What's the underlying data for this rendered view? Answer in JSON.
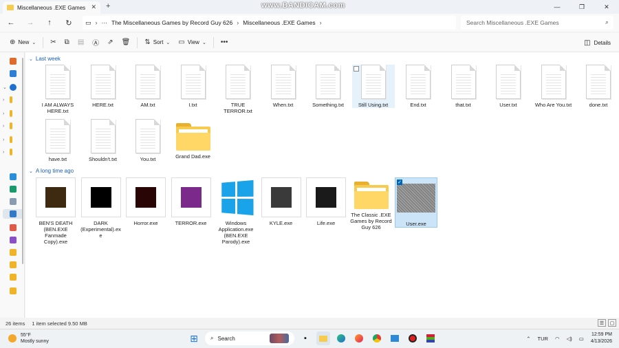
{
  "window": {
    "tab_title": "Miscellaneous .EXE Games",
    "watermark": "www.BANDICAM.com"
  },
  "address": {
    "crumbs": [
      "The Miscellaneous Games by Record Guy 626",
      "Miscellaneous .EXE Games"
    ],
    "search_placeholder": "Search Miscellaneous .EXE Games"
  },
  "commands": {
    "new": "New",
    "sort": "Sort",
    "view": "View",
    "details": "Details"
  },
  "groups": {
    "last_week": "Last week",
    "long_ago": "A long time ago"
  },
  "files_last_week": [
    {
      "name": "I AM ALWAYS HERE.txt",
      "kind": "doc"
    },
    {
      "name": "HERE.txt",
      "kind": "doc"
    },
    {
      "name": "AM.txt",
      "kind": "doc"
    },
    {
      "name": "I.txt",
      "kind": "doc"
    },
    {
      "name": "TRUE TERROR.txt",
      "kind": "doc"
    },
    {
      "name": "When.txt",
      "kind": "doc"
    },
    {
      "name": "Something.txt",
      "kind": "doc"
    },
    {
      "name": "Still Using.txt",
      "kind": "doc"
    },
    {
      "name": "End.txt",
      "kind": "doc"
    },
    {
      "name": "that.txt",
      "kind": "doc"
    },
    {
      "name": "User.txt",
      "kind": "doc"
    },
    {
      "name": "Who Are You.txt",
      "kind": "doc"
    },
    {
      "name": "done.txt",
      "kind": "doc"
    },
    {
      "name": "have.txt",
      "kind": "doc"
    },
    {
      "name": "Shouldn't.txt",
      "kind": "doc"
    },
    {
      "name": "You.txt",
      "kind": "doc"
    },
    {
      "name": "Grand Dad.exe",
      "kind": "folder"
    }
  ],
  "files_long_ago": [
    {
      "name": "BEN'S DEATH (BEN.EXE Fanmade Copy).exe",
      "kind": "thumb",
      "color": "#3d2a10"
    },
    {
      "name": "DARK (Experimental).exe",
      "kind": "thumb",
      "color": "#000000"
    },
    {
      "name": "Horror.exe",
      "kind": "thumb",
      "color": "#2a0505"
    },
    {
      "name": "TERROR.exe",
      "kind": "thumb",
      "color": "#7b2a8c"
    },
    {
      "name": "Windows Application.exe (BEN.EXE Parody).exe",
      "kind": "windows"
    },
    {
      "name": "KYLE.exe",
      "kind": "thumb",
      "color": "#3a3a3a"
    },
    {
      "name": "Life.exe",
      "kind": "thumb",
      "color": "#1a1a1a"
    },
    {
      "name": "The Classic .EXE Games by Record Guy 626",
      "kind": "folder"
    },
    {
      "name": "User.exe",
      "kind": "noise"
    }
  ],
  "status": {
    "count": "26 items",
    "selection": "1 item selected  9.50 MB"
  },
  "taskbar": {
    "temp": "55°F",
    "weather": "Mostly sunny",
    "search": "Search",
    "lang": "TUR",
    "time": "12:59 PM",
    "date": "4/13/2026"
  }
}
